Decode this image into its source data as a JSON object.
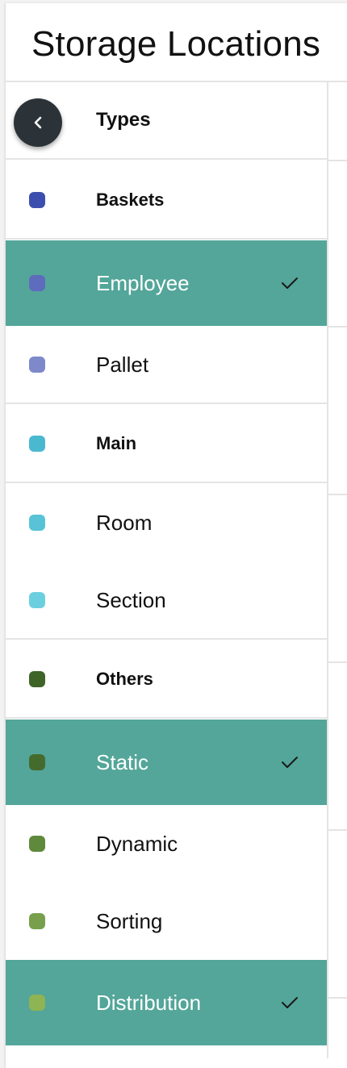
{
  "page": {
    "title": "Storage Locations"
  },
  "sidebar": {
    "header_label": "Types",
    "back_icon": "chevron-left-icon",
    "items": [
      {
        "label": "Baskets",
        "kind": "group",
        "color": "#3d4fae",
        "selected": false
      },
      {
        "label": "Employee",
        "kind": "item",
        "color": "#5f6bbd",
        "selected": true
      },
      {
        "label": "Pallet",
        "kind": "item",
        "color": "#7e89cb",
        "selected": false
      },
      {
        "label": "Main",
        "kind": "group",
        "color": "#4ab9d0",
        "selected": false
      },
      {
        "label": "Room",
        "kind": "item",
        "color": "#58c3d7",
        "selected": false
      },
      {
        "label": "Section",
        "kind": "item",
        "color": "#6ccfe0",
        "selected": false
      },
      {
        "label": "Others",
        "kind": "group",
        "color": "#3e6428",
        "selected": false
      },
      {
        "label": "Static",
        "kind": "item",
        "color": "#456b2c",
        "selected": true
      },
      {
        "label": "Dynamic",
        "kind": "item",
        "color": "#5f8a3c",
        "selected": false
      },
      {
        "label": "Sorting",
        "kind": "item",
        "color": "#78a04c",
        "selected": false
      },
      {
        "label": "Distribution",
        "kind": "item",
        "color": "#8fb454",
        "selected": true
      }
    ],
    "check_icon": "checkmark-icon"
  },
  "colors": {
    "selected_row": "#53a699",
    "back_button": "#2c3338"
  }
}
